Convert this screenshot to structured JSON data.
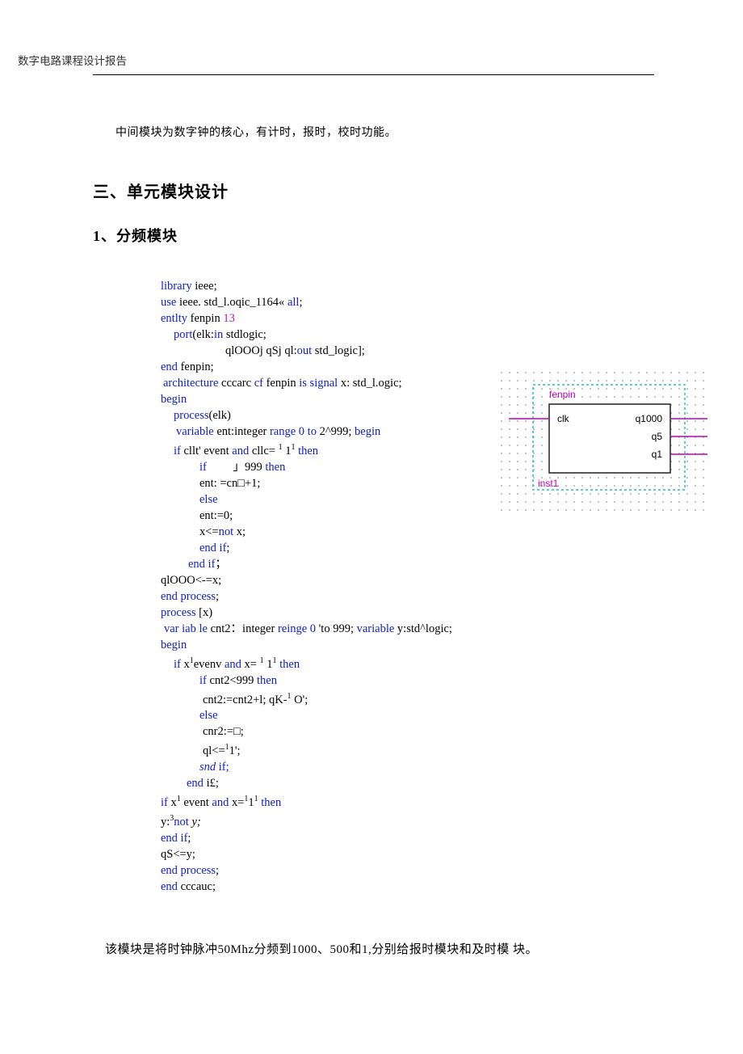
{
  "header": {
    "title": "数字电路课程设计报告"
  },
  "intro": "中间模块为数字钟的核心，有计时，报时，校时功能。",
  "section_heading": "三、单元模块设计",
  "subsection_heading": "1、分频模块",
  "code": {
    "l01a": "library",
    "l01b": " ieee;",
    "l02a": "use",
    "l02b": " ieee. std_l.oqic_1164« ",
    "l02c": "all",
    "l02d": ";",
    "l03a": "entlty",
    "l03b": " fenpin ",
    "l03c": "13",
    "l04a": "port",
    "l04b": "(elk:",
    "l04c": "in",
    "l04d": " stdlogic;",
    "l05a": "qlOOOj qSj ql:",
    "l05b": "out",
    "l05c": " std_logic];",
    "l06a": "end",
    "l06b": " fenpin;",
    "l07a": "architecture",
    "l07b": " cccarc ",
    "l07c": "cf",
    "l07d": " fenpin ",
    "l07e": "is signal",
    "l07f": " x: std_l.ogic;",
    "l08a": "begin",
    "l09a": "process",
    "l09b": "(elk)",
    "l10a": "variable",
    "l10b": " ent:integer ",
    "l10c": "range 0 to",
    "l10d": " 2^999; ",
    "l10e": "begin",
    "l11a": "if",
    "l11b": " cllt' event ",
    "l11c": "and",
    "l11d": " cllc= ",
    "l11e": "1",
    "l11f": " 1",
    "l11g": "1",
    "l11h": " then",
    "l12a": "if",
    "l12b": "         ",
    "l12pre": "」",
    "l12c": "999 ",
    "l12d": "then",
    "l13a": "ent: =cn□+1;",
    "l14a": "else",
    "l15a": "ent:=0;",
    "l16a": "x<=",
    "l16b": "not",
    "l16c": " x;",
    "l17a": "end if",
    "l17b": ";",
    "l18a": "end if",
    "l18b": "；",
    "l19a": "qlOOO<-=x;",
    "l20a": "end process",
    "l20b": ";",
    "l21a": "process",
    "l21b": " [x)",
    "l22a": "var iab le",
    "l22b": " cnt2：integer ",
    "l22c": "reinge 0",
    "l22d": " 'to 999; ",
    "l22e": "variable",
    "l22f": " y:std^logic;",
    "l23a": "begin",
    "l24a": "if",
    "l24b": " x",
    "l24c": "1",
    "l24d": "evenv ",
    "l24e": "and",
    "l24f": " x= ",
    "l24g": "1",
    "l24h": " 1",
    "l24i": "1",
    "l24j": " then",
    "l25a": "if",
    "l25b": " cnt2<999 ",
    "l25c": "then",
    "l26a": "cnt2:=cnt2+l; qK-",
    "l26b": "1",
    "l26c": " O';",
    "l27a": "else",
    "l28a": "cnr2:=□;",
    "l29a": "ql<=",
    "l29b": "1",
    "l29c": "1';",
    "l30a": "snd",
    "l30b": " if;",
    "l31a": "end",
    "l31b": " i£;",
    "l32a": "if",
    "l32b": " x",
    "l32c": "1",
    "l32d": " event ",
    "l32e": "and",
    "l32f": " x=",
    "l32g": "1",
    "l32h": "1",
    "l32i": "1",
    "l32j": " then",
    "l33a": "y:",
    "l33b": "3",
    "l33c": "not",
    "l33d": " y;",
    "l34a": "end if",
    "l34b": ";",
    "l35a": "qS<=y;",
    "l36a": "end process",
    "l36b": ";",
    "l37a": "end",
    "l37b": " cccauc;"
  },
  "diagram": {
    "entity_label": "fenpin",
    "inst_label": "inst1",
    "port_in": "clk",
    "port_out1": "q1000",
    "port_out2": "q5",
    "port_out3": "q1"
  },
  "footer": "该模块是将时钟脉冲50Mhz分频到1000、500和1,分别给报时模块和及时模 块。"
}
